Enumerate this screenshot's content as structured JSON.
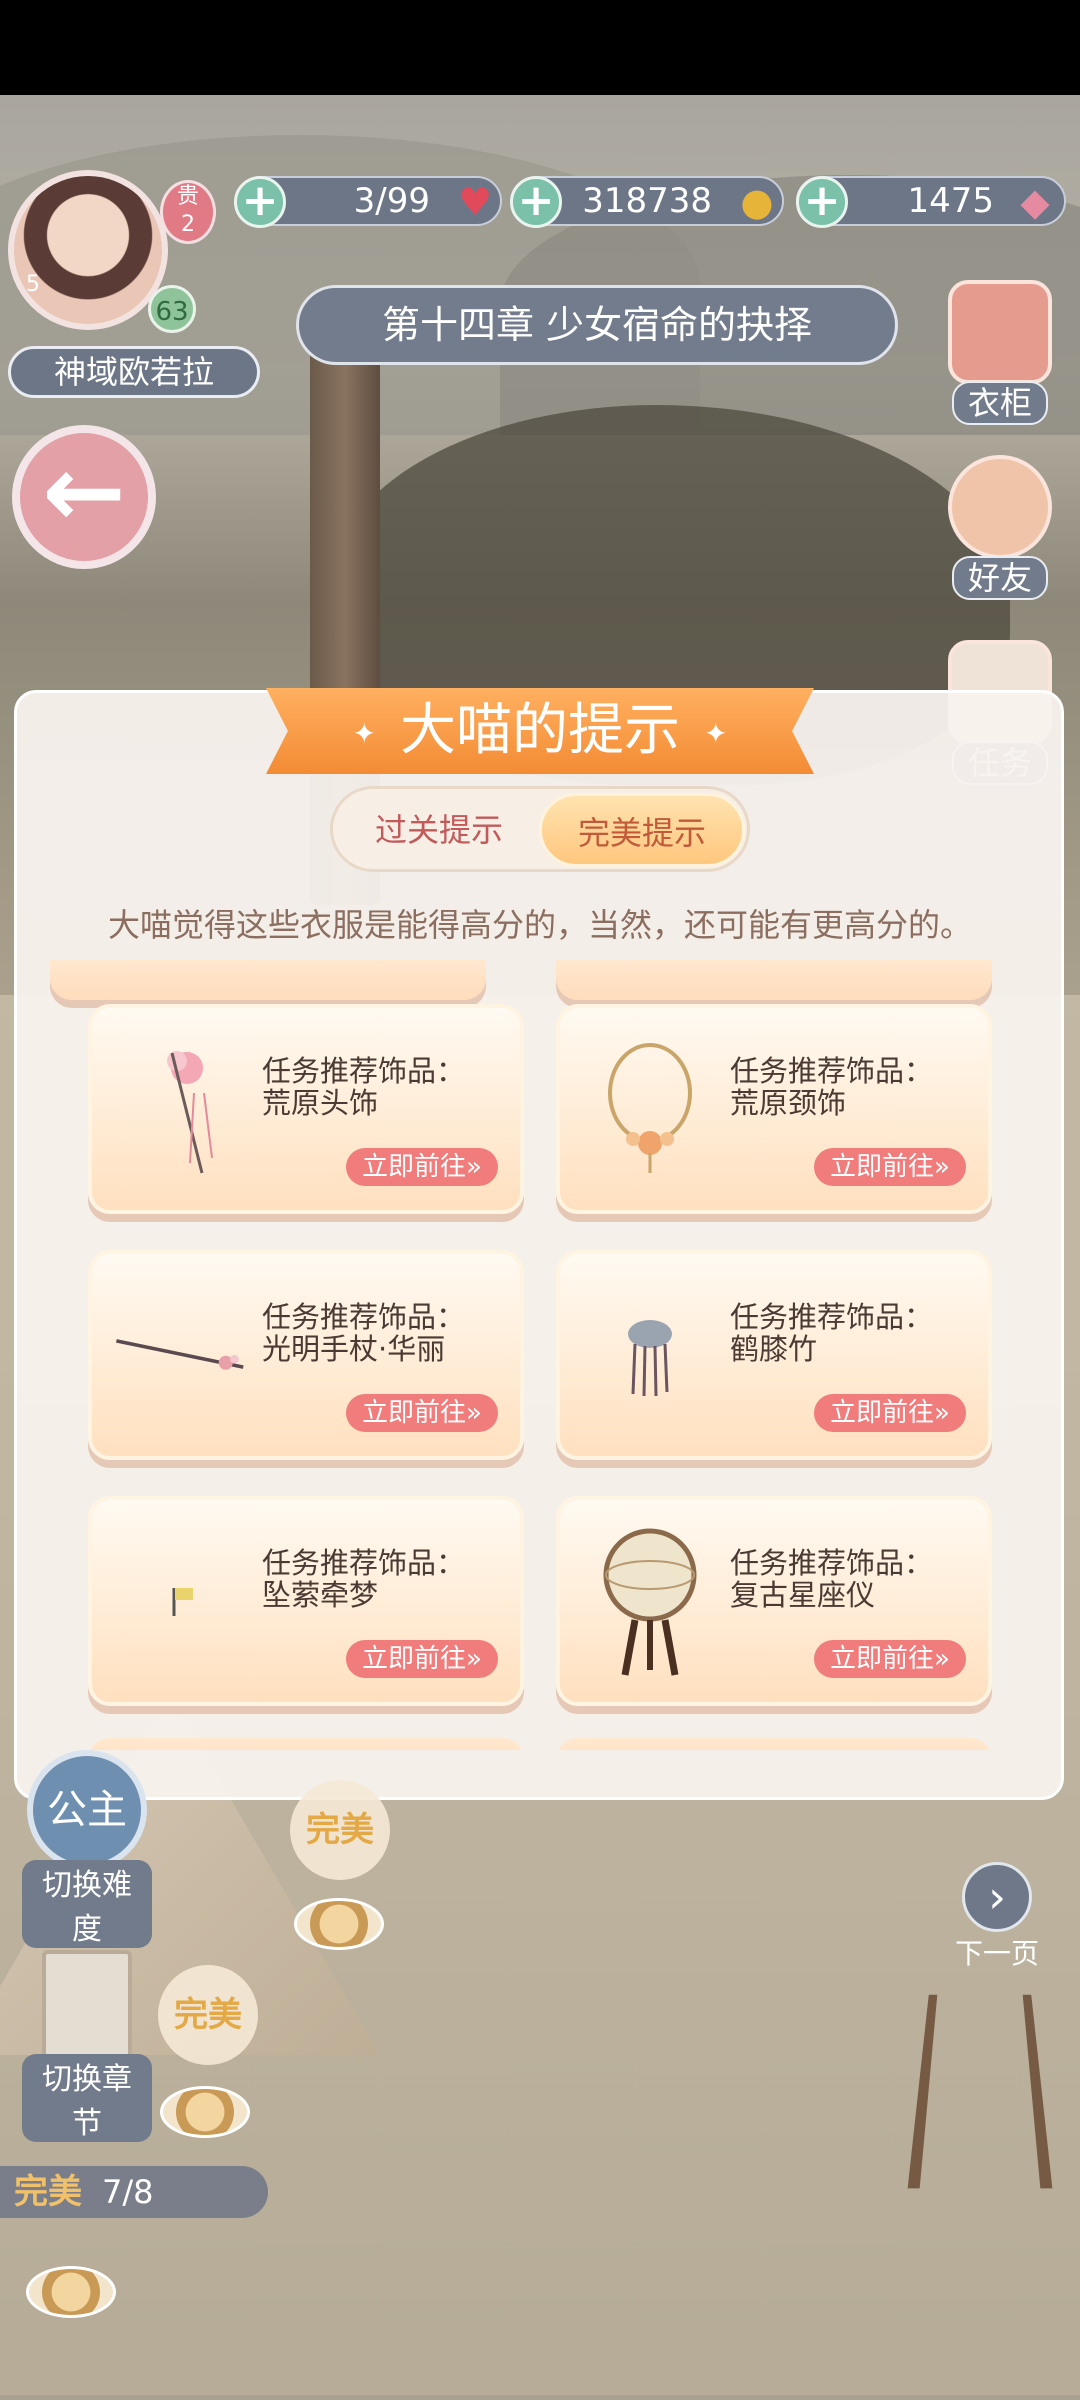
{
  "hud": {
    "player_name": "神域欧若拉",
    "vip_label": "贵",
    "vip_level": "2",
    "level": "63",
    "avatar_sub": "5",
    "stamina": "3/99",
    "gold": "318738",
    "diamonds": "1475",
    "chapter_title": "第十四章 少女宿命的抉择"
  },
  "side_buttons": {
    "wardrobe": "衣柜",
    "friends": "好友",
    "tasks": "任务"
  },
  "dialog": {
    "title": "大喵的提示",
    "tab_pass": "过关提示",
    "tab_perfect": "完美提示",
    "hint_text": "大喵觉得这些衣服是能得高分的，当然，还可能有更高分的。",
    "items": [
      {
        "title": "任务推荐饰品：",
        "name": "荒原头饰",
        "button": "立即前往»",
        "icon": "hairpin-icon"
      },
      {
        "title": "任务推荐饰品：",
        "name": "荒原颈饰",
        "button": "立即前往»",
        "icon": "necklace-icon"
      },
      {
        "title": "任务推荐饰品：",
        "name": "光明手杖·华丽",
        "button": "立即前往»",
        "icon": "staff-icon"
      },
      {
        "title": "任务推荐饰品：",
        "name": "鹤膝竹",
        "button": "立即前往»",
        "icon": "charm-icon"
      },
      {
        "title": "任务推荐饰品：",
        "name": "坠萦牵梦",
        "button": "立即前往»",
        "icon": "flag-icon"
      },
      {
        "title": "任务推荐饰品：",
        "name": "复古星座仪",
        "button": "立即前往»",
        "icon": "globe-icon"
      }
    ]
  },
  "bottom": {
    "difficulty_circle": "公主",
    "difficulty_label": "切换难度",
    "chapter_label": "切换章节",
    "perfect": "完美",
    "progress_label": "完美",
    "progress_value": "7/8",
    "next_page": "下一页"
  },
  "colors": {
    "accent_orange": "#f38b34",
    "button_red": "#f07c7c",
    "hud_panel": "#6d7687"
  }
}
